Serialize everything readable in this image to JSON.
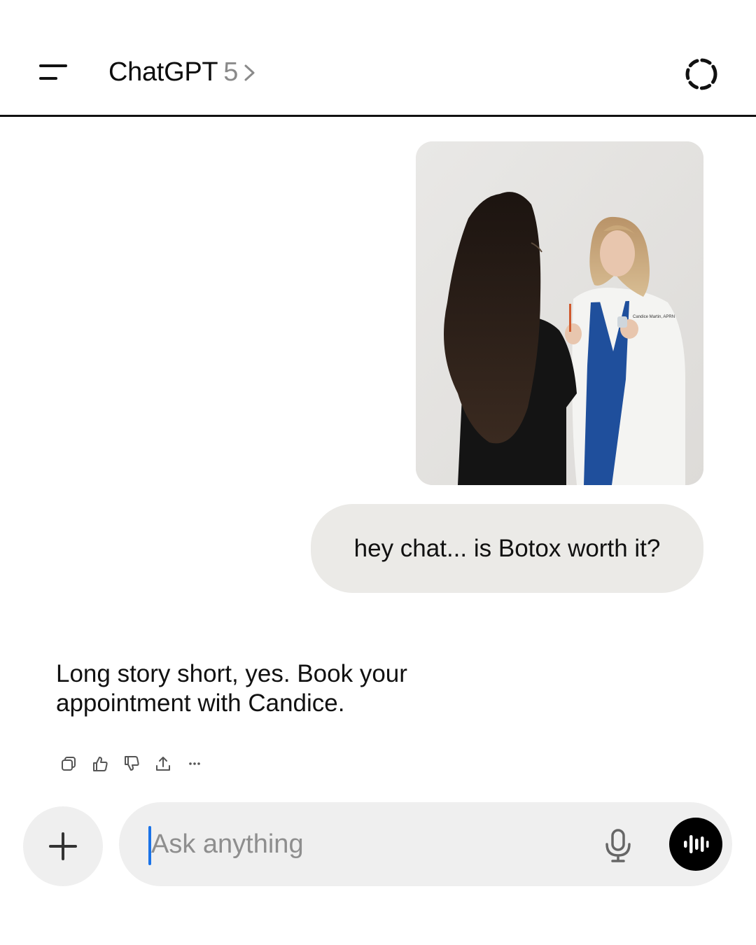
{
  "header": {
    "app_name": "ChatGPT",
    "model_version": "5",
    "menu_icon": "hamburger-menu-icon",
    "temporary_chat_icon": "dashed-circle-icon"
  },
  "conversation": {
    "user_image": {
      "alt": "Two women in a clinic, one in a white coat holding a syringe",
      "coat_embroidery": "Candice Martin, APRN"
    },
    "user_message": "hey chat... is Botox worth it?",
    "assistant_message": "Long story short, yes. Book your appointment with Candice.",
    "actions": [
      "copy-icon",
      "thumbs-up-icon",
      "thumbs-down-icon",
      "share-icon",
      "more-icon"
    ]
  },
  "composer": {
    "placeholder": "Ask anything",
    "value": "",
    "plus_icon": "plus-icon",
    "mic_icon": "microphone-icon",
    "voice_icon": "voice-mode-icon"
  },
  "colors": {
    "bubble": "#ebeae7",
    "composer": "#efefef",
    "caret": "#1a73e8",
    "voice_button": "#000000"
  }
}
